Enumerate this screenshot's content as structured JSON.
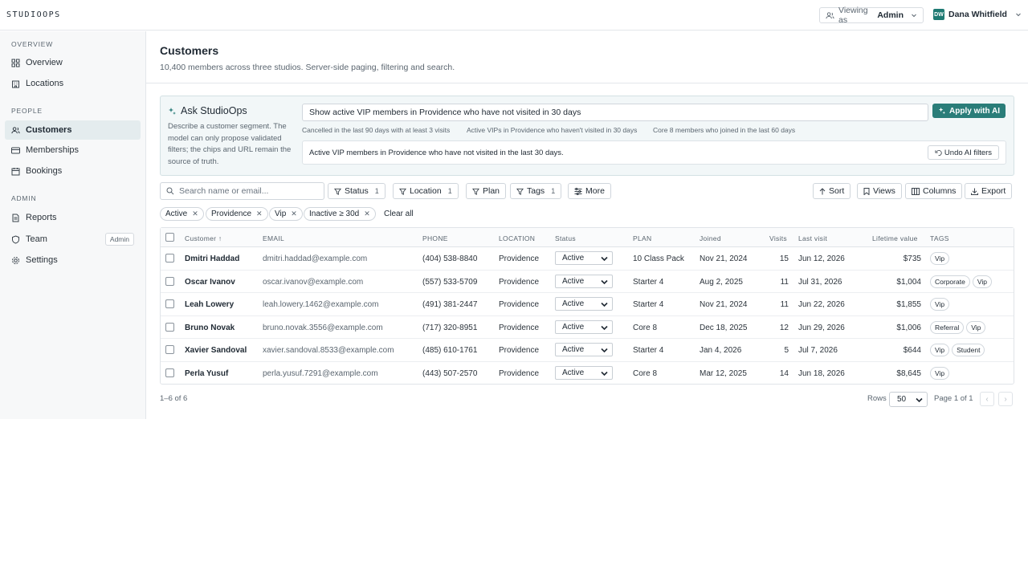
{
  "app": {
    "logo": "STUDIOOPS"
  },
  "topbar": {
    "viewing_prefix": "Viewing as",
    "viewing_role": "Admin",
    "user_initials": "DW",
    "user_name": "Dana Whitfield"
  },
  "sidebar": {
    "sections": [
      {
        "label": "OVERVIEW",
        "items": [
          {
            "label": "Overview",
            "icon": "grid-icon"
          },
          {
            "label": "Locations",
            "icon": "building-icon"
          }
        ]
      },
      {
        "label": "PEOPLE",
        "items": [
          {
            "label": "Customers",
            "icon": "users-icon",
            "active": true
          },
          {
            "label": "Memberships",
            "icon": "card-icon"
          },
          {
            "label": "Bookings",
            "icon": "calendar-icon"
          }
        ]
      },
      {
        "label": "ADMIN",
        "items": [
          {
            "label": "Reports",
            "icon": "file-icon"
          },
          {
            "label": "Team",
            "icon": "shield-icon",
            "badge": "Admin"
          },
          {
            "label": "Settings",
            "icon": "gear-icon"
          }
        ]
      }
    ]
  },
  "page": {
    "title": "Customers",
    "subtitle": "10,400 members across three studios. Server-side paging, filtering and search."
  },
  "ai": {
    "title": "Ask StudioOps",
    "description": "Describe a customer segment. The model can only propose validated filters; the chips and URL remain the source of truth.",
    "query": "Show active VIP members in Providence who have not visited in 30 days",
    "apply_label": "Apply with AI",
    "suggestions": [
      "Cancelled in the last 90 days with at least 3 visits",
      "Active VIPs in Providence who haven't visited in 30 days",
      "Core 8 members who joined in the last 60 days"
    ],
    "result": "Active VIP members in Providence who have not visited in the last 30 days.",
    "undo_label": "Undo AI filters"
  },
  "toolbar": {
    "search_placeholder": "Search name or email...",
    "filters": [
      {
        "label": "Status",
        "count": "1"
      },
      {
        "label": "Location",
        "count": "1"
      },
      {
        "label": "Plan",
        "count": ""
      },
      {
        "label": "Tags",
        "count": "1"
      },
      {
        "label": "More",
        "count": ""
      }
    ],
    "sort_label": "Sort",
    "views_label": "Views",
    "columns_label": "Columns",
    "export_label": "Export"
  },
  "chips": [
    "Active",
    "Providence",
    "Vip",
    "Inactive ≥ 30d"
  ],
  "clear_all": "Clear all",
  "table": {
    "headers": {
      "customer": "Customer ↑",
      "email": "EMAIL",
      "phone": "PHONE",
      "location": "LOCATION",
      "status": "Status",
      "plan": "PLAN",
      "joined": "Joined",
      "visits": "Visits",
      "last_visit": "Last visit",
      "lifetime": "Lifetime value",
      "tags": "TAGS"
    },
    "rows": [
      {
        "name": "Dmitri Haddad",
        "email": "dmitri.haddad@example.com",
        "phone": "(404) 538-8840",
        "location": "Providence",
        "status": "Active",
        "plan": "10 Class Pack",
        "joined": "Nov 21, 2024",
        "visits": "15",
        "last_visit": "Jun 12, 2026",
        "lifetime": "$735",
        "tags": [
          "Vip"
        ]
      },
      {
        "name": "Oscar Ivanov",
        "email": "oscar.ivanov@example.com",
        "phone": "(557) 533-5709",
        "location": "Providence",
        "status": "Active",
        "plan": "Starter 4",
        "joined": "Aug 2, 2025",
        "visits": "11",
        "last_visit": "Jul 31, 2026",
        "lifetime": "$1,004",
        "tags": [
          "Corporate",
          "Vip"
        ]
      },
      {
        "name": "Leah Lowery",
        "email": "leah.lowery.1462@example.com",
        "phone": "(491) 381-2447",
        "location": "Providence",
        "status": "Active",
        "plan": "Starter 4",
        "joined": "Nov 21, 2024",
        "visits": "11",
        "last_visit": "Jun 22, 2026",
        "lifetime": "$1,855",
        "tags": [
          "Vip"
        ]
      },
      {
        "name": "Bruno Novak",
        "email": "bruno.novak.3556@example.com",
        "phone": "(717) 320-8951",
        "location": "Providence",
        "status": "Active",
        "plan": "Core 8",
        "joined": "Dec 18, 2025",
        "visits": "12",
        "last_visit": "Jun 29, 2026",
        "lifetime": "$1,006",
        "tags": [
          "Referral",
          "Vip"
        ]
      },
      {
        "name": "Xavier Sandoval",
        "email": "xavier.sandoval.8533@example.com",
        "phone": "(485) 610-1761",
        "location": "Providence",
        "status": "Active",
        "plan": "Starter 4",
        "joined": "Jan 4, 2026",
        "visits": "5",
        "last_visit": "Jul 7, 2026",
        "lifetime": "$644",
        "tags": [
          "Vip",
          "Student"
        ]
      },
      {
        "name": "Perla Yusuf",
        "email": "perla.yusuf.7291@example.com",
        "phone": "(443) 507-2570",
        "location": "Providence",
        "status": "Active",
        "plan": "Core 8",
        "joined": "Mar 12, 2025",
        "visits": "14",
        "last_visit": "Jun 18, 2026",
        "lifetime": "$8,645",
        "tags": [
          "Vip"
        ]
      }
    ]
  },
  "footer": {
    "range": "1–6 of 6",
    "rows_label": "Rows",
    "rows_value": "50",
    "page_label": "Page 1 of 1"
  },
  "colors": {
    "accent": "#2a7d79",
    "active_nav": "#e4ecee",
    "sidebar_bg": "#f7f8f9",
    "ai_panel_bg": "#f2f7f8"
  }
}
